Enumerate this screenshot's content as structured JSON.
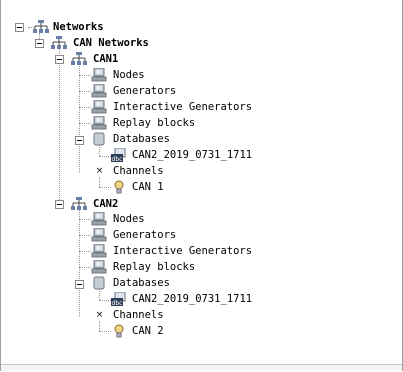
{
  "tree": {
    "root": "Networks",
    "can_networks": "CAN Networks",
    "can1": {
      "label": "CAN1",
      "nodes": "Nodes",
      "generators": "Generators",
      "interactive_generators": "Interactive Generators",
      "replay_blocks": "Replay blocks",
      "databases": "Databases",
      "database_file": "CAN2_2019_0731_1711",
      "channels": "Channels",
      "channel": "CAN 1"
    },
    "can2": {
      "label": "CAN2",
      "nodes": "Nodes",
      "generators": "Generators",
      "interactive_generators": "Interactive Generators",
      "replay_blocks": "Replay blocks",
      "databases": "Databases",
      "database_file": "CAN2_2019_0731_1711",
      "channels": "Channels",
      "channel": "CAN 2"
    }
  },
  "icons": {
    "network": "network-icon",
    "node": "computer-icon",
    "database": "database-icon",
    "db_file": "dbc-file-icon",
    "channel": "can-channel-icon"
  },
  "colors": {
    "border": "#a0a0a0",
    "tree_line": "#9a9a9a"
  }
}
